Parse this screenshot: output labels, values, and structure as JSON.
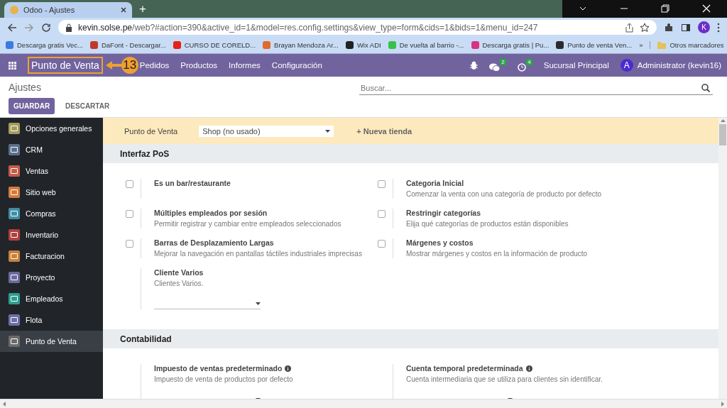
{
  "browser": {
    "tab_title": "Odoo - Ajustes",
    "new_tab": "+",
    "url_host": "kevin.solse.pe",
    "url_path": "/web?#action=390&active_id=1&model=res.config.settings&view_type=form&cids=1&bids=1&menu_id=247",
    "profile_initial": "K",
    "bookmarks": [
      {
        "label": "Descarga gratis Vec...",
        "color": "#3b7be0"
      },
      {
        "label": "DaFont - Descargar...",
        "color": "#c0392b"
      },
      {
        "label": "CURSO DE CORELD...",
        "color": "#e62117"
      },
      {
        "label": "Brayan Mendoza Ar...",
        "color": "#e2692c"
      },
      {
        "label": "Wix ADI",
        "color": "#222222"
      },
      {
        "label": "De vuelta al barrio -...",
        "color": "#36c24a"
      },
      {
        "label": "Descarga gratis | Pu...",
        "color": "#d63384"
      },
      {
        "label": "Punto de venta Ven...",
        "color": "#2b2b2b"
      }
    ],
    "more": "»",
    "other_bookmarks": "Otros marcadores"
  },
  "navbar": {
    "app_name": "Punto de Venta",
    "menu": [
      "Pedidos",
      "Productos",
      "Informes",
      "Configuración"
    ],
    "messages_count": "2",
    "activities_count": "4",
    "company": "Sucursal Principal",
    "user_initial": "A",
    "user": "Administrator (kevin16)"
  },
  "annotation": {
    "step": "13"
  },
  "control_panel": {
    "title": "Ajustes",
    "search_placeholder": "Buscar...",
    "buttons": [
      {
        "label": "GUARDAR",
        "kind": "primary"
      },
      {
        "label": "DESCARTAR",
        "kind": "secondary"
      }
    ]
  },
  "sidebar": {
    "items": [
      {
        "label": "Opciones generales",
        "color": "#a39c5a",
        "selected": false
      },
      {
        "label": "CRM",
        "color": "#5a6f8c",
        "selected": false
      },
      {
        "label": "Ventas",
        "color": "#c45c4a",
        "selected": false
      },
      {
        "label": "Sitio web",
        "color": "#d47a3a",
        "selected": false
      },
      {
        "label": "Compras",
        "color": "#3f8fa6",
        "selected": false
      },
      {
        "label": "Inventario",
        "color": "#b0413e",
        "selected": false
      },
      {
        "label": "Facturacion",
        "color": "#c9803a",
        "selected": false
      },
      {
        "label": "Proyecto",
        "color": "#6c6a9c",
        "selected": false
      },
      {
        "label": "Empleados",
        "color": "#2f9d8f",
        "selected": false
      },
      {
        "label": "Flota",
        "color": "#6d6fa5",
        "selected": false
      },
      {
        "label": "Punto de Venta",
        "color": "#6b6b6b",
        "selected": true
      }
    ]
  },
  "pos_bar": {
    "label": "Punto de Venta",
    "value": "Shop (no usado)",
    "link": "+ Nueva tienda"
  },
  "sections": [
    {
      "title": "Interfaz PoS",
      "settings": [
        {
          "kind": "checkbox",
          "label": "Es un bar/restaurante",
          "checked": false
        },
        {
          "kind": "checkbox",
          "label": "Categoria Inicial",
          "description": "Comenzar la venta con una categoría de producto por defecto",
          "checked": false
        },
        {
          "kind": "checkbox",
          "label": "Múltiples empleados por sesión",
          "description": "Permitir registrar y cambiar entre empleados seleccionados",
          "checked": false
        },
        {
          "kind": "checkbox",
          "label": "Restringir categorías",
          "description": "Elija qué categorías de productos están disponibles",
          "checked": false
        },
        {
          "kind": "checkbox",
          "label": "Barras de Desplazamiento Largas",
          "description": "Mejorar la navegación en pantallas táctiles industriales imprecisas",
          "checked": false
        },
        {
          "kind": "checkbox",
          "label": "Márgenes y costos",
          "description": "Mostrar márgenes y costos en la información de producto",
          "checked": false
        },
        {
          "kind": "select",
          "label": "Cliente Varios",
          "description": "Clientes Varios."
        }
      ]
    },
    {
      "title": "Contabilidad",
      "settings": [
        {
          "kind": "select",
          "label": "Impuesto de ventas predeterminado",
          "description": "Impuesto de venta de productos por defecto",
          "help_icon": true
        },
        {
          "kind": "select",
          "label": "Cuenta temporal predeterminada",
          "description": "Cuenta intermediaria que se utiliza para clientes sin identificar.",
          "help_icon": true
        }
      ]
    }
  ]
}
